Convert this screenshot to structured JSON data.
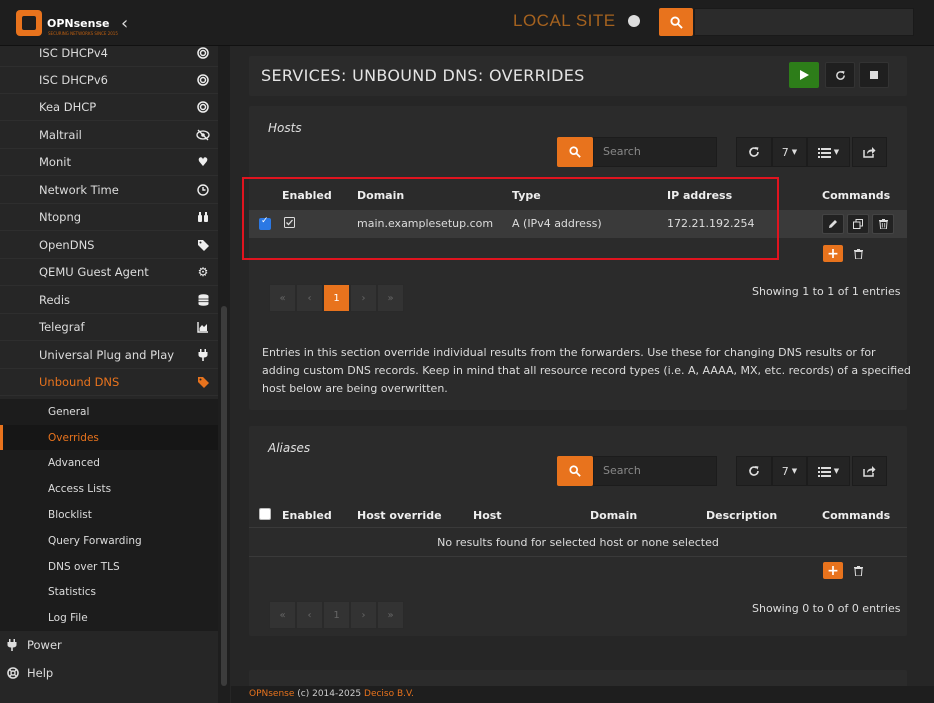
{
  "topbar": {
    "logo_text": "OPNsense",
    "logo_sub": "SECURING NETWORKS SINCE 2015",
    "site_label": "LOCAL SITE"
  },
  "sidebar": {
    "items": [
      {
        "label": "ISC DHCPv4",
        "icon": "target-icon"
      },
      {
        "label": "ISC DHCPv6",
        "icon": "target-icon"
      },
      {
        "label": "Kea DHCP",
        "icon": "target-icon"
      },
      {
        "label": "Maltrail",
        "icon": "eye-slash-icon"
      },
      {
        "label": "Monit",
        "icon": "heartbeat-icon"
      },
      {
        "label": "Network Time",
        "icon": "clock-icon"
      },
      {
        "label": "Ntopng",
        "icon": "binoculars-icon"
      },
      {
        "label": "OpenDNS",
        "icon": "tags-icon"
      },
      {
        "label": "QEMU Guest Agent",
        "icon": "gear-icon"
      },
      {
        "label": "Redis",
        "icon": "database-icon"
      },
      {
        "label": "Telegraf",
        "icon": "area-chart-icon"
      },
      {
        "label": "Universal Plug and Play",
        "icon": "plug-icon"
      },
      {
        "label": "Unbound DNS",
        "icon": "tags-icon"
      }
    ],
    "subitems": [
      "General",
      "Overrides",
      "Advanced",
      "Access Lists",
      "Blocklist",
      "Query Forwarding",
      "DNS over TLS",
      "Statistics",
      "Log File"
    ],
    "bottom": [
      {
        "label": "Power",
        "icon": "plug-icon"
      },
      {
        "label": "Help",
        "icon": "lifesaver-icon"
      }
    ]
  },
  "page": {
    "title": "SERVICES: UNBOUND DNS: OVERRIDES"
  },
  "hosts": {
    "title": "Hosts",
    "search_placeholder": "Search",
    "page_size": "7",
    "columns": {
      "enabled": "Enabled",
      "domain": "Domain",
      "type": "Type",
      "ip": "IP address",
      "commands": "Commands"
    },
    "rows": [
      {
        "domain": "main.examplesetup.com",
        "type": "A (IPv4 address)",
        "ip": "172.21.192.254"
      }
    ],
    "pager": [
      "«",
      "‹",
      "1",
      "›",
      "»"
    ],
    "showing": "Showing 1 to 1 of 1 entries",
    "note": "Entries in this section override individual results from the forwarders. Use these for changing DNS results or for adding custom DNS records. Keep in mind that all resource record types (i.e. A, AAAA, MX, etc. records) of a specified host below are being overwritten."
  },
  "aliases": {
    "title": "Aliases",
    "search_placeholder": "Search",
    "page_size": "7",
    "columns": {
      "enabled": "Enabled",
      "host_override": "Host override",
      "host": "Host",
      "domain": "Domain",
      "description": "Description",
      "commands": "Commands"
    },
    "empty": "No results found for selected host or none selected",
    "pager": [
      "«",
      "‹",
      "1",
      "›",
      "»"
    ],
    "showing": "Showing 0 to 0 of 0 entries"
  },
  "footer": {
    "brand": "OPNsense",
    "copy": " (c) 2014-2025 ",
    "company": "Deciso B.V."
  }
}
